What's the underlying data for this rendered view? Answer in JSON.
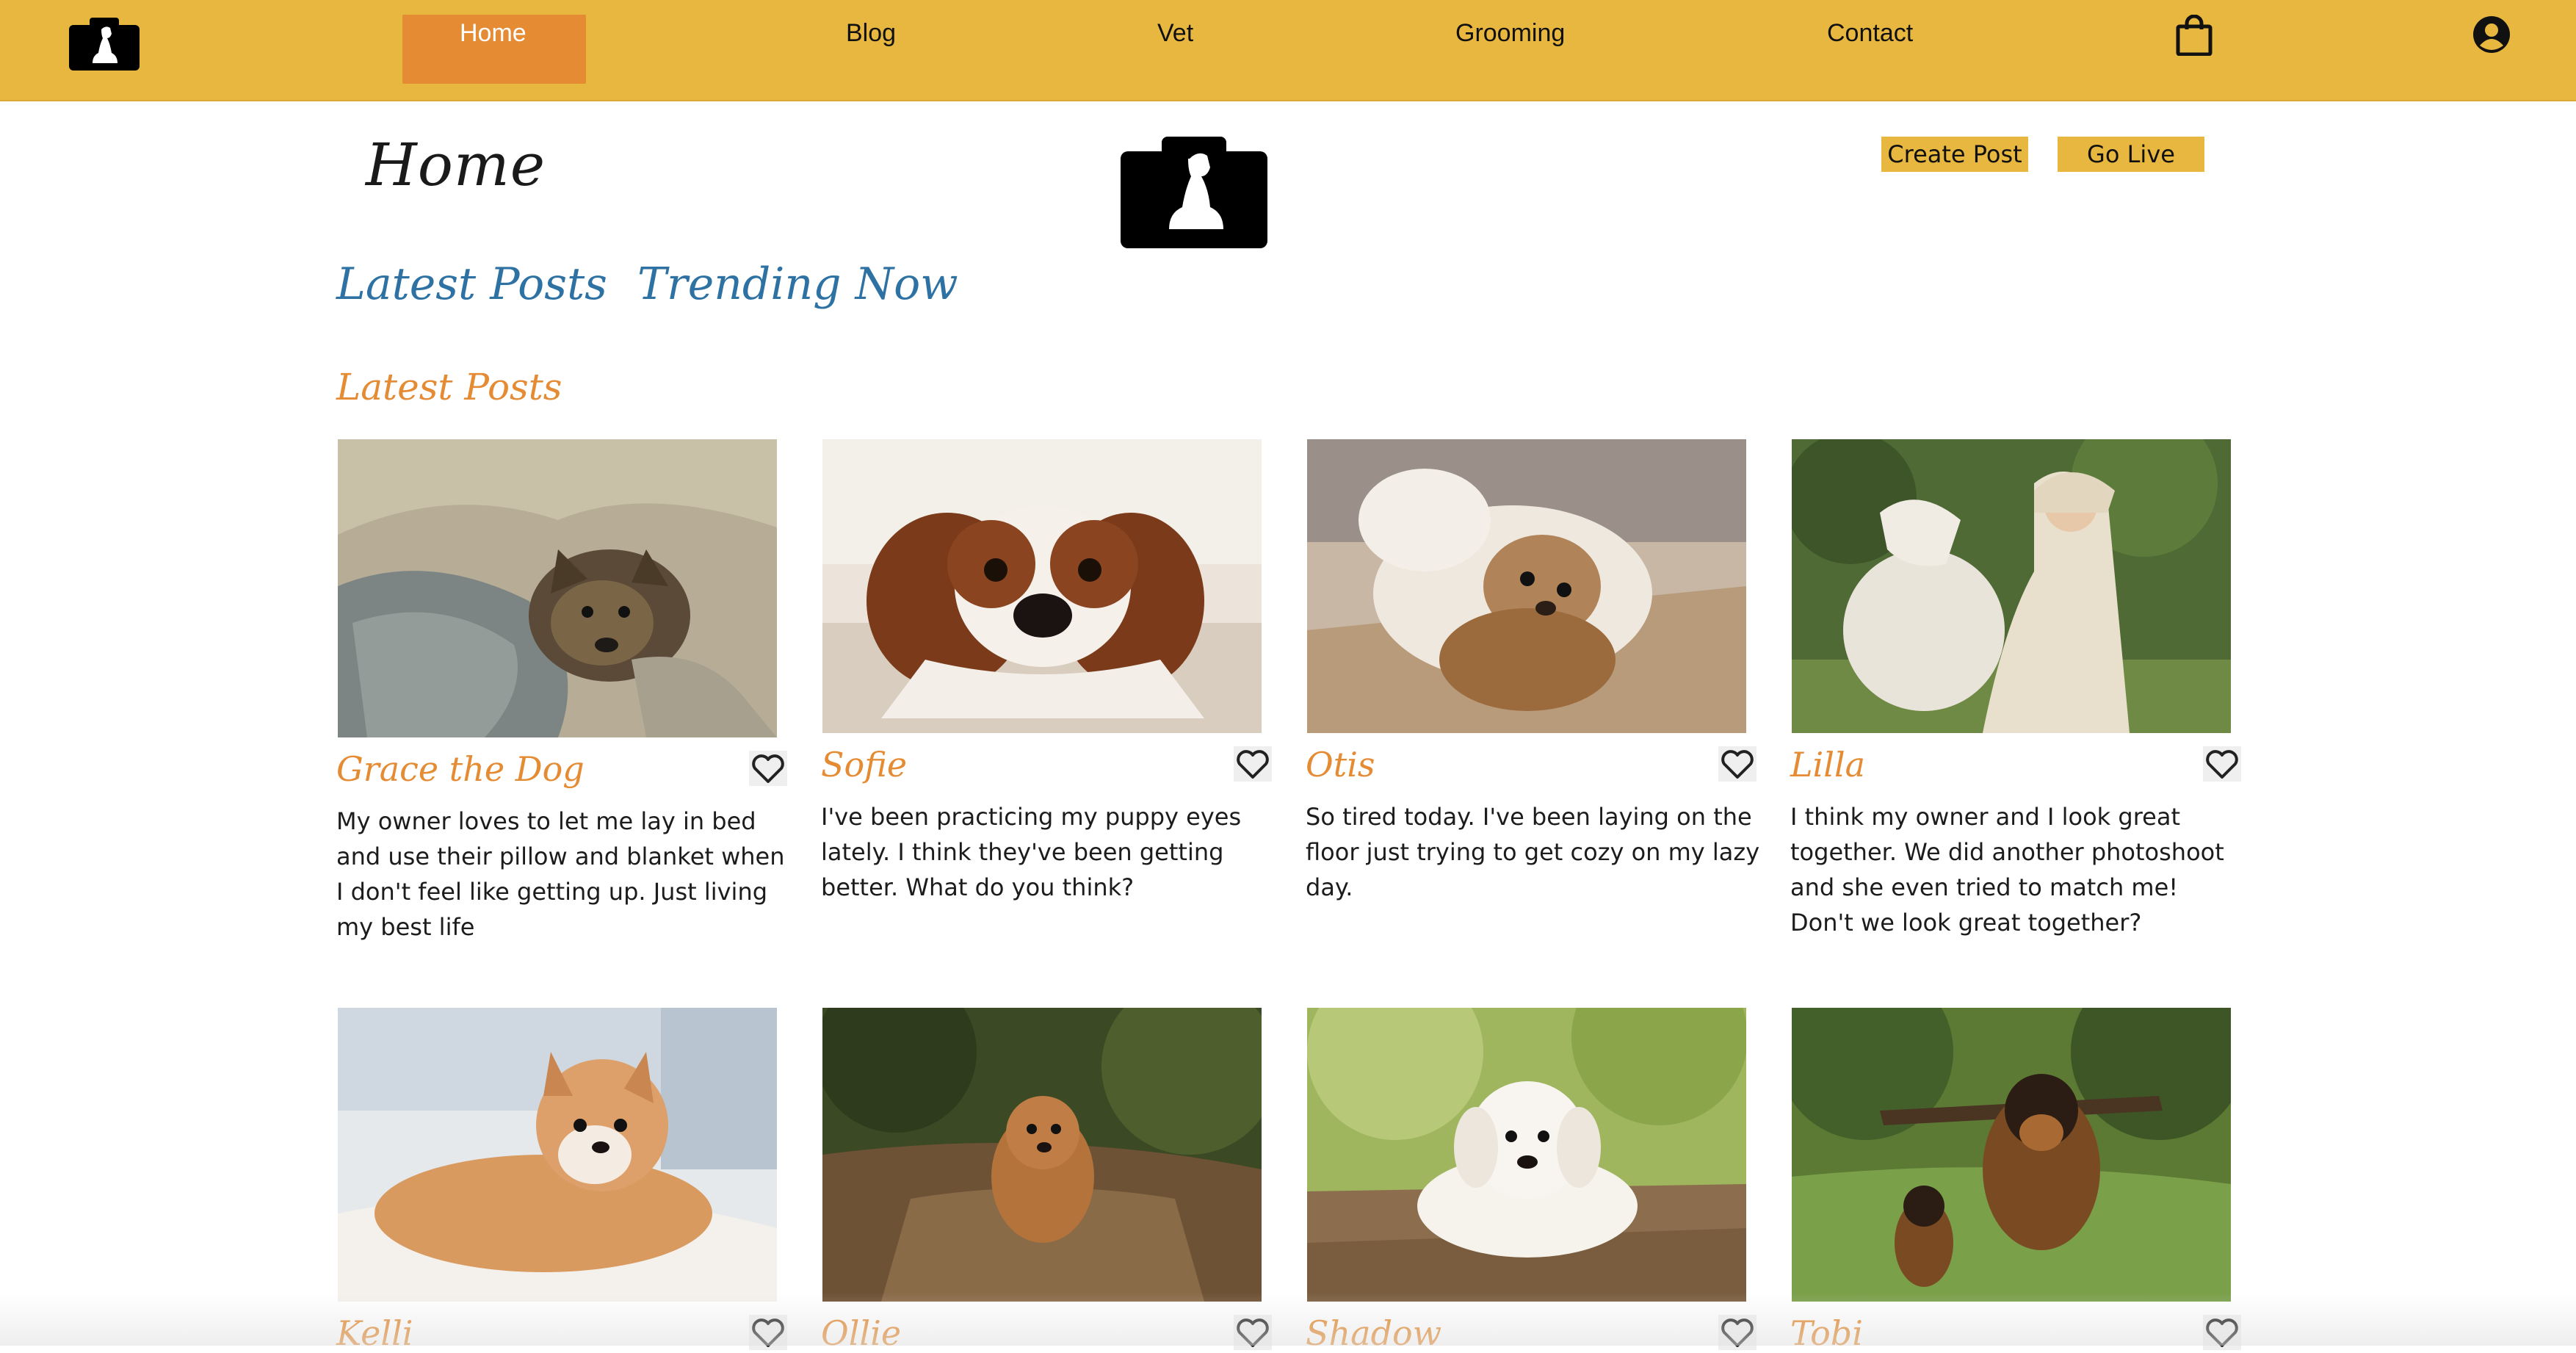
{
  "nav": {
    "logo_icon": "dog-camera-logo-icon",
    "links": [
      {
        "label": "Home",
        "active": true
      },
      {
        "label": "Blog"
      },
      {
        "label": "Vet"
      },
      {
        "label": "Grooming"
      },
      {
        "label": "Contact"
      }
    ],
    "cart_icon": "shopping-bag-icon",
    "account_icon": "user-circle-icon"
  },
  "header": {
    "title": "Home",
    "logo_icon": "dog-camera-logo-icon",
    "create_post_label": "Create Post",
    "go_live_label": "Go Live"
  },
  "tabs": [
    {
      "label": "Latest Posts"
    },
    {
      "label": "Trending Now"
    }
  ],
  "section": {
    "heading": "Latest Posts"
  },
  "posts": [
    {
      "name": "Grace the Dog",
      "text": "My owner loves to let me lay in bed and use their pillow and blanket when I don't feel like getting up. Just living my best life",
      "heart_icon": "heart-outline-icon"
    },
    {
      "name": "Sofie",
      "text": "I've been practicing my puppy eyes lately. I think they've been getting better. What do you think?",
      "heart_icon": "heart-outline-icon"
    },
    {
      "name": "Otis",
      "text": "So tired today. I've been laying on the floor just trying to get cozy on my lazy day.",
      "heart_icon": "heart-outline-icon"
    },
    {
      "name": "Lilla",
      "text": "I think my owner and I look great together. We did another photoshoot and she even tried to match me! Don't we look great together?",
      "heart_icon": "heart-outline-icon"
    },
    {
      "name": "Kelli",
      "text": "",
      "heart_icon": "heart-outline-icon"
    },
    {
      "name": "Ollie",
      "text": "",
      "heart_icon": "heart-outline-icon"
    },
    {
      "name": "Shadow",
      "text": "",
      "heart_icon": "heart-outline-icon"
    },
    {
      "name": "Tobi",
      "text": "",
      "heart_icon": "heart-outline-icon"
    }
  ],
  "colors": {
    "nav_bg": "#e8b73f",
    "nav_active": "#e48b33",
    "tab_text": "#2e72a3",
    "accent_orange": "#e48b33"
  }
}
